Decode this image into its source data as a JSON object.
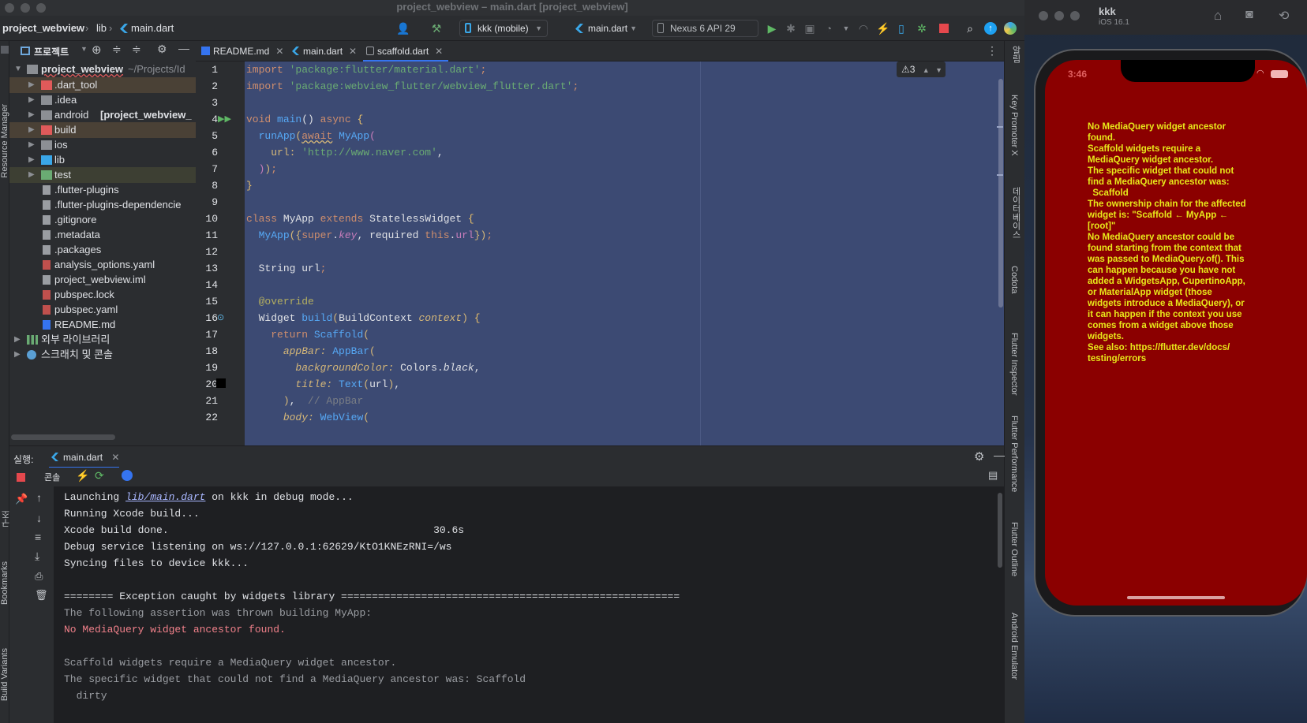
{
  "window": {
    "title": "project_webview – main.dart [project_webview]"
  },
  "toolbar": {
    "breadcrumb": [
      "project_webview",
      "lib",
      "main.dart"
    ],
    "device_selector": "kkk (mobile)",
    "config_selector": "main.dart",
    "emulator_selector": "Nexus 6 API 29"
  },
  "project_panel": {
    "title": "프로젝트",
    "root": {
      "name": "project_webview",
      "path": "~/Projects/Id"
    },
    "items": [
      {
        "label": ".dart_tool",
        "type": "folder",
        "color": "#e05a5a"
      },
      {
        "label": ".idea",
        "type": "folder"
      },
      {
        "label": "android",
        "suffix": "[project_webview_",
        "type": "folder"
      },
      {
        "label": "build",
        "type": "folder",
        "color": "#e05a5a"
      },
      {
        "label": "ios",
        "type": "folder"
      },
      {
        "label": "lib",
        "type": "folder",
        "color": "#3aa7e8"
      },
      {
        "label": "test",
        "type": "folder",
        "color": "#6aab73"
      },
      {
        "label": ".flutter-plugins",
        "type": "file"
      },
      {
        "label": ".flutter-plugins-dependencie",
        "type": "file"
      },
      {
        "label": ".gitignore",
        "type": "file"
      },
      {
        "label": ".metadata",
        "type": "file"
      },
      {
        "label": ".packages",
        "type": "file"
      },
      {
        "label": "analysis_options.yaml",
        "type": "yaml"
      },
      {
        "label": "project_webview.iml",
        "type": "file"
      },
      {
        "label": "pubspec.lock",
        "type": "file"
      },
      {
        "label": "pubspec.yaml",
        "type": "yaml"
      },
      {
        "label": "README.md",
        "type": "md"
      },
      {
        "label": "외부 라이브러리",
        "type": "lib"
      },
      {
        "label": "스크래치 및 콘솔",
        "type": "scratch"
      }
    ]
  },
  "tabs": [
    {
      "label": "README.md"
    },
    {
      "label": "main.dart"
    },
    {
      "label": "scaffold.dart"
    }
  ],
  "editor": {
    "warning_count": "3",
    "line_numbers": [
      "1",
      "2",
      "3",
      "4",
      "5",
      "6",
      "7",
      "8",
      "9",
      "10",
      "11",
      "12",
      "13",
      "14",
      "15",
      "16",
      "17",
      "18",
      "19",
      "20",
      "21",
      "22"
    ]
  },
  "run_panel": {
    "label": "실행:",
    "tab": "main.dart",
    "console_tab": "콘솔"
  },
  "console": {
    "lines": [
      {
        "prefix": "Launching ",
        "link": "lib/main.dart",
        "suffix": " on kkk in debug mode..."
      },
      {
        "text": "Running Xcode build..."
      },
      {
        "text": "Xcode build done.                                           30.6s"
      },
      {
        "text": "Debug service listening on ws://127.0.0.1:62629/KtO1KNEzRNI=/ws"
      },
      {
        "text": "Syncing files to device kkk..."
      },
      {
        "text": ""
      },
      {
        "text": "======== Exception caught by widgets library ======================================================="
      },
      {
        "text": "The following assertion was thrown building MyApp:",
        "style": "gray"
      },
      {
        "text": "No MediaQuery widget ancestor found.",
        "style": "red"
      },
      {
        "text": ""
      },
      {
        "text": "Scaffold widgets require a MediaQuery widget ancestor.",
        "style": "gray"
      },
      {
        "text": "The specific widget that could not find a MediaQuery ancestor was: Scaffold",
        "style": "gray"
      },
      {
        "text": "  dirty",
        "style": "gray"
      }
    ]
  },
  "right_strip": [
    "알림",
    "Key Promoter X",
    "데이터베이스",
    "Codota",
    "Flutter Inspector",
    "Flutter Performance",
    "Flutter Outline",
    "Android Emulator"
  ],
  "left_strip": [
    "Resource Manager",
    "구조",
    "Bookmarks",
    "Build Variants"
  ],
  "simulator": {
    "device_name": "kkk",
    "os": "iOS 16.1",
    "time": "3:46",
    "error_text": "No MediaQuery widget ancestor\nfound.\nScaffold widgets require a\nMediaQuery widget ancestor.\nThe specific widget that could not\nfind a MediaQuery ancestor was:\n  Scaffold\nThe ownership chain for the affected\nwidget is: \"Scaffold ← MyApp ←\n[root]\"\nNo MediaQuery ancestor could be\nfound starting from the context that\nwas passed to MediaQuery.of(). This\ncan happen because you have not\nadded a WidgetsApp, CupertinoApp,\nor MaterialApp widget (those\nwidgets introduce a MediaQuery), or\nit can happen if the context you use\ncomes from a widget above those\nwidgets.\nSee also: https://flutter.dev/docs/\ntesting/errors"
  }
}
